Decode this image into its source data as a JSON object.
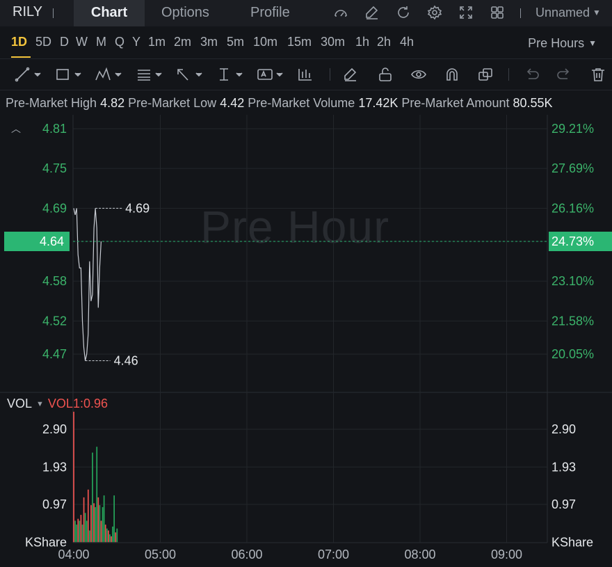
{
  "header": {
    "ticker": "RILY",
    "tabs": [
      "Chart",
      "Options",
      "Profile"
    ],
    "layout_name": "Unnamed",
    "icons": [
      "gauge-icon",
      "edit-icon",
      "refresh-icon",
      "gear-icon",
      "fullscreen-icon",
      "grid-layout-icon"
    ]
  },
  "timeframes": {
    "items": [
      "1D",
      "5D",
      "D",
      "W",
      "M",
      "Q",
      "Y",
      "1m",
      "2m",
      "3m",
      "5m",
      "10m",
      "15m",
      "30m",
      "1h",
      "2h",
      "4h"
    ],
    "active": "1D",
    "session": "Pre Hours"
  },
  "draw_tools": [
    "line-tool-icon",
    "rectangle-tool-icon",
    "pattern-tool-icon",
    "fib-tool-icon",
    "arrow-tool-icon",
    "measure-tool-icon",
    "text-tool-icon",
    "indicator-tool-icon",
    "pencil-icon",
    "unlock-icon",
    "eye-icon",
    "magnet-icon",
    "copy-icon",
    "undo-icon",
    "redo-icon",
    "trash-icon"
  ],
  "stats": {
    "high_label": "Pre-Market High",
    "high": "4.82",
    "low_label": "Pre-Market Low",
    "low": "4.42",
    "volume_label": "Pre-Market Volume",
    "volume": "17.42K",
    "amount_label": "Pre-Market Amount",
    "amount": "80.55K"
  },
  "watermark": "Pre Hour",
  "volume_panel": {
    "label": "VOL",
    "indicator": "VOL1:0.96",
    "unit": "KShare"
  },
  "colors": {
    "up": "#26a65b",
    "down": "#ef5350",
    "price_line": "#c9cdd4",
    "current_price_bg": "#2bb673"
  },
  "chart_data": [
    {
      "type": "line",
      "x": [
        "04:00",
        "04:01",
        "04:02",
        "04:03",
        "04:04",
        "04:05",
        "04:06",
        "04:07",
        "04:08",
        "04:09",
        "04:10",
        "04:11",
        "04:12",
        "04:13",
        "04:14",
        "04:15",
        "04:16",
        "04:17",
        "04:18",
        "04:19",
        "04:20",
        "04:21",
        "04:22",
        "04:23",
        "04:24",
        "04:25",
        "04:26",
        "04:27",
        "04:28",
        "04:29",
        "04:30"
      ],
      "series": [
        {
          "values": [
            4.69,
            4.68,
            4.69,
            4.62,
            4.6,
            4.6,
            4.52,
            4.48,
            4.46,
            4.47,
            4.5,
            4.61,
            4.55,
            4.56,
            4.66,
            4.69,
            4.66,
            4.54,
            4.6,
            4.64,
            4.64,
            4.64,
            4.64,
            4.64,
            4.64,
            4.64,
            4.64,
            4.64,
            4.64,
            4.64,
            4.64
          ]
        }
      ],
      "x_ticks": [
        "04:00",
        "05:00",
        "06:00",
        "07:00",
        "08:00",
        "09:00"
      ],
      "y_ticks": [
        "4.81",
        "4.75",
        "4.69",
        "4.64",
        "4.58",
        "4.52",
        "4.47"
      ],
      "y_right_ticks": [
        "29.21%",
        "27.69%",
        "26.16%",
        "24.73%",
        "23.10%",
        "21.58%",
        "20.05%"
      ],
      "current_price": "4.64",
      "current_pct": "24.73%",
      "marked_high": "4.69",
      "marked_low": "4.46",
      "ylim": [
        4.44,
        4.83
      ],
      "grid": true
    },
    {
      "type": "bar",
      "x": [
        "04:00",
        "04:01",
        "04:02",
        "04:03",
        "04:04",
        "04:05",
        "04:06",
        "04:07",
        "04:08",
        "04:09",
        "04:10",
        "04:11",
        "04:12",
        "04:13",
        "04:14",
        "04:15",
        "04:16",
        "04:17",
        "04:18",
        "04:19",
        "04:20",
        "04:21",
        "04:22",
        "04:23",
        "04:24",
        "04:25",
        "04:26",
        "04:27",
        "04:28",
        "04:29",
        "04:30"
      ],
      "values": [
        3.35,
        0.55,
        0.45,
        0.6,
        0.55,
        0.7,
        0.45,
        1.15,
        0.75,
        0.55,
        1.35,
        0.3,
        0.95,
        2.3,
        1.0,
        0.9,
        2.45,
        1.15,
        0.95,
        0.55,
        0.9,
        1.2,
        0.45,
        0.35,
        0.3,
        0.2,
        0.15,
        0.4,
        1.2,
        0.25,
        0.35
      ],
      "directions": [
        "down",
        "up",
        "up",
        "down",
        "up",
        "down",
        "up",
        "down",
        "up",
        "up",
        "down",
        "up",
        "down",
        "up",
        "down",
        "up",
        "up",
        "down",
        "up",
        "down",
        "up",
        "up",
        "down",
        "up",
        "down",
        "up",
        "down",
        "up",
        "up",
        "down",
        "up"
      ],
      "y_ticks": [
        "2.90",
        "1.93",
        "0.97"
      ],
      "ylim": [
        0,
        3.45
      ]
    }
  ]
}
